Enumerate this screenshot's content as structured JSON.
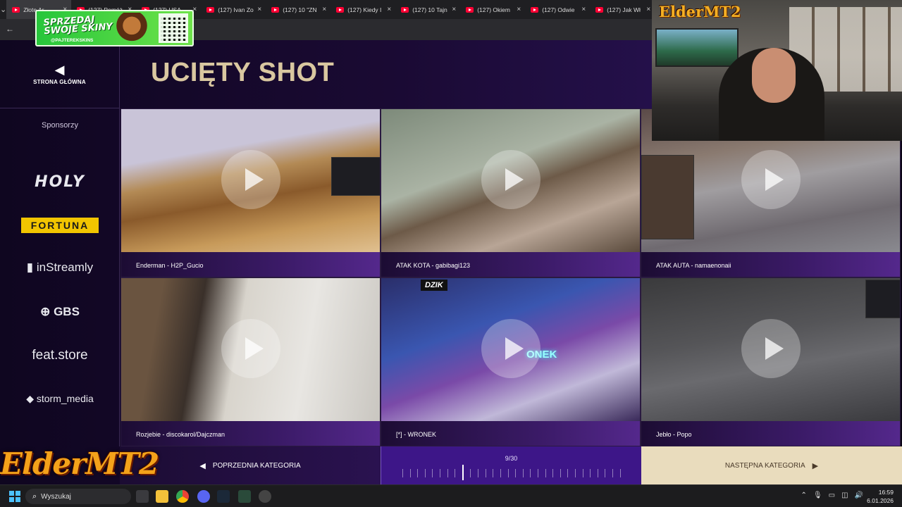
{
  "browser": {
    "tabs": [
      {
        "label": "Złote Ar…",
        "active": true
      },
      {
        "label": "(127) Pomóż"
      },
      {
        "label": "(127) USA"
      },
      {
        "label": "(127) Ivan Zo"
      },
      {
        "label": "(127) 10 \"ZN"
      },
      {
        "label": "(127) Kiedy I"
      },
      {
        "label": "(127) 10 Tajn"
      },
      {
        "label": "(127) Okiem"
      },
      {
        "label": "(127) Odwie"
      },
      {
        "label": "(127) Jak Wł"
      }
    ]
  },
  "promo": {
    "line1": "SPRZEDAJ",
    "line2": "SWOJE SKINY",
    "handle": "@PAJTEREKSKINS"
  },
  "header": {
    "home_label": "STRONA GŁÓWNA",
    "title": "UCIĘTY SHOT"
  },
  "sidebar": {
    "heading": "Sponsorzy",
    "sponsors": [
      "HOLY",
      "FORTUNA",
      "inStreamly",
      "GBS",
      "feat.store",
      "storm_media"
    ]
  },
  "clips": [
    {
      "caption": "Enderman - H2P_Gucio"
    },
    {
      "caption": "ATAK KOTA - gabibagi123"
    },
    {
      "caption": "ATAK AUTA - namaenonaii"
    },
    {
      "caption": "Rozjebie - discokarol/Dajczman"
    },
    {
      "caption": "[*] - WRONEK"
    },
    {
      "caption": "Jebło - Popo"
    }
  ],
  "thumb_overlays": {
    "clip5_badge": "DZIK",
    "clip5_neon": "ONEK"
  },
  "footer": {
    "prev_label": "POPRZEDNIA KATEGORIA",
    "next_label": "NASTĘPNA KATEGORIA",
    "counter": "9/30",
    "current": 9,
    "total": 30
  },
  "overlay": {
    "brand_top": "ElderMT2",
    "brand_logo": "ElderMT2"
  },
  "taskbar": {
    "search_label": "Wyszukaj",
    "time": "16:59",
    "date": "6.01.2026"
  }
}
